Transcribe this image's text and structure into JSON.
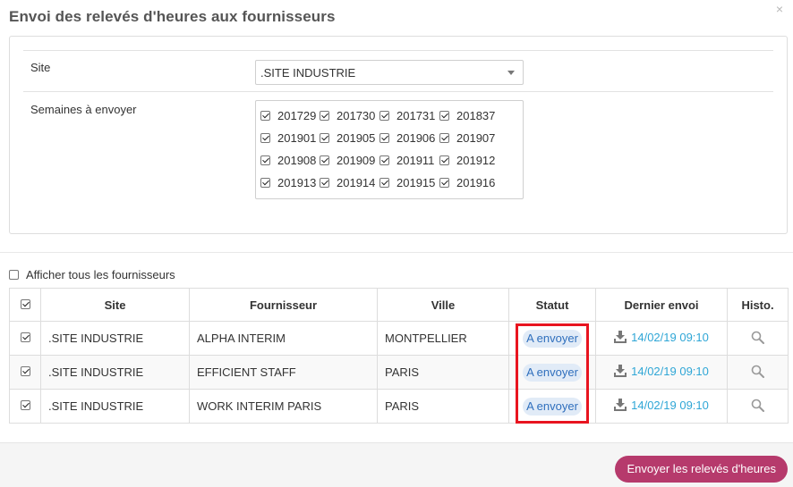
{
  "modal": {
    "title": "Envoi des relevés d'heures aux fournisseurs",
    "close_glyph": "×"
  },
  "form": {
    "site_label": "Site",
    "site_value": ".SITE INDUSTRIE",
    "weeks_label": "Semaines à envoyer",
    "weeks": [
      "201729",
      "201730",
      "201731",
      "201837",
      "201901",
      "201905",
      "201906",
      "201907",
      "201908",
      "201909",
      "201911",
      "201912",
      "201913",
      "201914",
      "201915",
      "201916"
    ]
  },
  "show_all": {
    "label": "Afficher tous les fournisseurs",
    "checked": false
  },
  "table": {
    "headers": [
      "Site",
      "Fournisseur",
      "Ville",
      "Statut",
      "Dernier envoi",
      "Histo."
    ],
    "rows": [
      {
        "site": ".SITE INDUSTRIE",
        "supplier": "ALPHA INTERIM",
        "city": "MONTPELLIER",
        "status": "A envoyer",
        "last_send": "14/02/19 09:10"
      },
      {
        "site": ".SITE INDUSTRIE",
        "supplier": "EFFICIENT STAFF",
        "city": "PARIS",
        "status": "A envoyer",
        "last_send": "14/02/19 09:10"
      },
      {
        "site": ".SITE INDUSTRIE",
        "supplier": "WORK INTERIM PARIS",
        "city": "PARIS",
        "status": "A envoyer",
        "last_send": "14/02/19 09:10"
      }
    ]
  },
  "footer": {
    "send_label": "Envoyer les relevés d'heures"
  },
  "colors": {
    "accent": "#b63a6c",
    "status_bg": "#e1ebf7",
    "status_text": "#2f6fbd",
    "link": "#2fa6d6",
    "highlight": "#e8141f"
  }
}
